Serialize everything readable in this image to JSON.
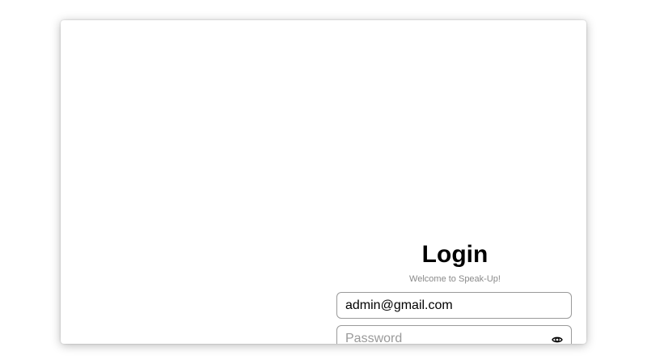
{
  "login": {
    "title": "Login",
    "subtitle": "Welcome to Speak-Up!",
    "email_value": "admin@gmail.com",
    "password_placeholder": "Password",
    "icons": {
      "password_toggle": "eye-icon"
    }
  }
}
